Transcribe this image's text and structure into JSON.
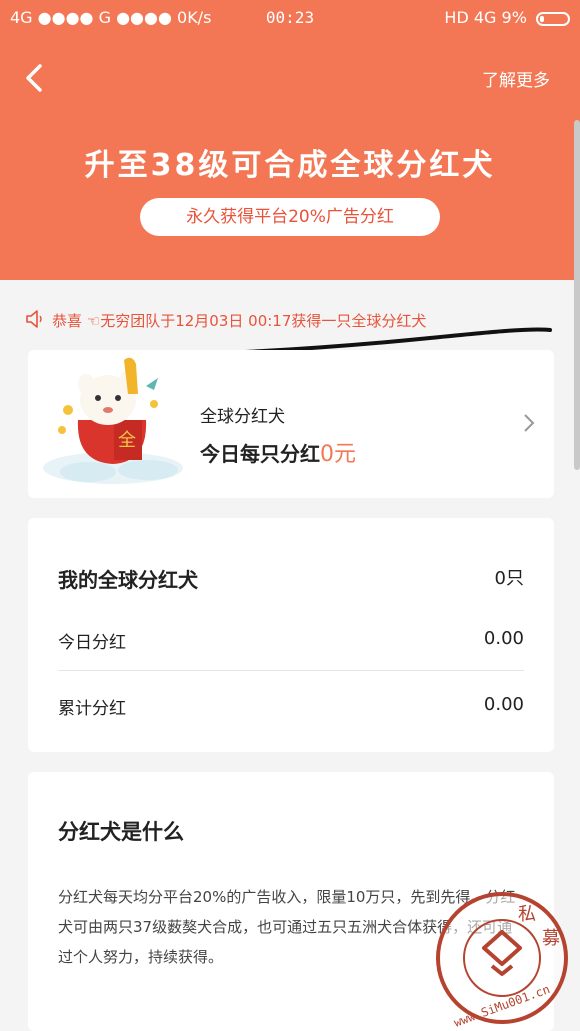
{
  "status_bar": {
    "left": "4G ●●●● G ●●●● 0K/s",
    "time": "00:23",
    "right": "HD 4G 9%"
  },
  "header": {
    "learn_more": "了解更多",
    "title": "升至38级可合成全球分红犬",
    "subtitle": "永久获得平台20%广告分红"
  },
  "marquee": {
    "text": "恭喜 ☜无穷团队于12月03日 00:17获得一只全球分红犬"
  },
  "dividend_card": {
    "label": "全球分红犬",
    "value_prefix": "今日每只分红",
    "value_amount": "0",
    "value_unit": "元"
  },
  "my_dogs": {
    "title": "我的全球分红犬",
    "count": "0只",
    "rows": [
      {
        "label": "今日分红",
        "value": "0.00"
      },
      {
        "label": "累计分红",
        "value": "0.00"
      }
    ]
  },
  "about": {
    "title": "分红犬是什么",
    "body": "分红犬每天均分平台20%的广告收入，限量10万只，先到先得。分红犬可由两只37级薮獒犬合成，也可通过五只五洲犬合体获得，还可通过个人努力，持续获得。"
  },
  "watermark": {
    "text": "www.SiMu001.cn",
    "chars": "私募"
  },
  "colors": {
    "header": "#f47755",
    "accent": "#e8533a"
  },
  "icons": [
    "back-icon",
    "speaker-icon",
    "chevron-right-icon"
  ]
}
